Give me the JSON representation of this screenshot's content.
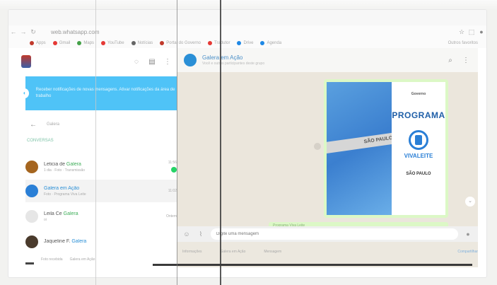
{
  "browser": {
    "url": "web.whatsapp.com",
    "bookmarks": [
      {
        "label": "Apps",
        "color": "#c0392b"
      },
      {
        "label": "Gmail",
        "color": "#e53935"
      },
      {
        "label": "Maps",
        "color": "#43a047"
      },
      {
        "label": "YouTube",
        "color": "#e53935"
      },
      {
        "label": "Notícias",
        "color": "#666666"
      },
      {
        "label": "Portal do Governo",
        "color": "#c0392b"
      },
      {
        "label": "Tradutor",
        "color": "#e53935"
      },
      {
        "label": "Drive",
        "color": "#1e88e5"
      },
      {
        "label": "Agenda",
        "color": "#1e88e5"
      }
    ],
    "bookmarks_extra": "Outros favoritos"
  },
  "sidebar": {
    "notice_text": "Receber notificações de novas mensagens. Ativar notificações da área de trabalho",
    "search_label": "Galera",
    "filter_label": "CONVERSAS",
    "chats": [
      {
        "name": "Leticia de ",
        "group": "Galera",
        "group_color": "g",
        "preview": "1 dia · Foto · Transmissão",
        "time": "11:56",
        "unread": true,
        "avatar_color": "#a5651f",
        "active": false
      },
      {
        "name": "",
        "group": "Galera em Ação",
        "group_color": "b",
        "preview": "Foto · Programa Viva Leite",
        "time": "11:02",
        "unread": false,
        "avatar_color": "#2a7fd6",
        "active": true
      },
      {
        "name": "Leila Ce ",
        "group": "Galera",
        "group_color": "g",
        "preview": "oi",
        "time": "Ontem",
        "unread": false,
        "avatar_color": "#e6e6e6",
        "active": false
      },
      {
        "name": "Jaqueline F. ",
        "group": "Galera",
        "group_color": "b",
        "preview": "",
        "time": "",
        "unread": false,
        "avatar_color": "#4a3a2c",
        "active": false
      }
    ],
    "footer": [
      "Foto recebida",
      "Galera em Ação"
    ]
  },
  "conversation": {
    "title": "Galera em Ação",
    "subtitle": "Você e outros participantes deste grupo",
    "image_caption": "Programa Viva Leite",
    "composer_placeholder": "Digite uma mensagem",
    "image": {
      "badge": "Governo",
      "title": "PROGRAMA",
      "program": "VIVALEITE",
      "sign_label": "SÃO PAULO",
      "strip_label": "SÃO PAULO"
    },
    "taskbar": [
      "Informações",
      "Galera em Ação",
      "Mensagem",
      "Compartilhar"
    ]
  },
  "colors": {
    "notice": "#4fc3f7",
    "whatsapp_green": "#25d366",
    "chat_bg": "#ebe6dc",
    "bubble_green": "#dcf8c6",
    "program_blue": "#1f5fa8"
  }
}
